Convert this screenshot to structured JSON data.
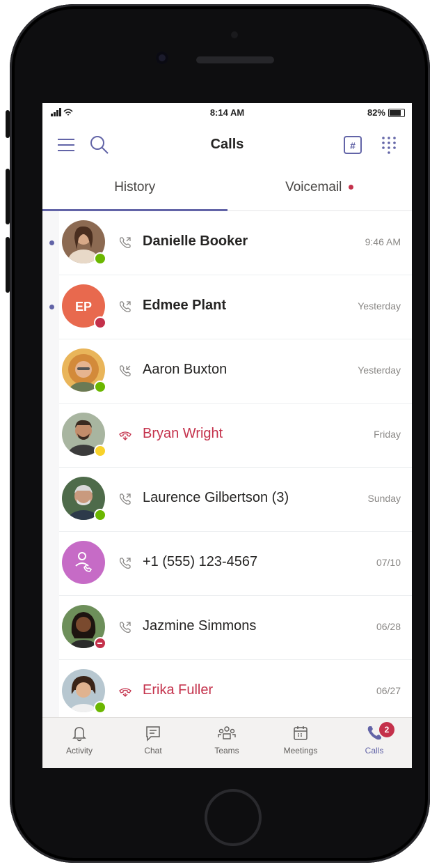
{
  "status": {
    "signal": "atl",
    "time": "8:14 AM",
    "battery": "82%"
  },
  "header": {
    "title": "Calls",
    "menu_icon": "hamburger-menu-icon",
    "search_icon": "search-icon",
    "dialpad_icon": "keypad-icon",
    "grid_icon": "dial-grid-icon"
  },
  "tabs": [
    {
      "label": "History",
      "active": true
    },
    {
      "label": "Voicemail",
      "has_indicator": true
    }
  ],
  "calls": [
    {
      "name": "Danielle Booker",
      "time": "9:46 AM",
      "bold": true,
      "unread": true,
      "missed": false,
      "presence": "available",
      "avatar": "photo"
    },
    {
      "name": "Edmee Plant",
      "time": "Yesterday",
      "bold": true,
      "unread": true,
      "missed": false,
      "presence": "busy",
      "avatar": "initials",
      "initials": "EP"
    },
    {
      "name": "Aaron Buxton",
      "time": "Yesterday",
      "bold": false,
      "unread": false,
      "missed": false,
      "presence": "available",
      "avatar": "photo"
    },
    {
      "name": "Bryan Wright",
      "time": "Friday",
      "bold": false,
      "unread": false,
      "missed": true,
      "presence": "away",
      "avatar": "photo"
    },
    {
      "name": "Laurence Gilbertson (3)",
      "time": "Sunday",
      "bold": false,
      "unread": false,
      "missed": false,
      "presence": "available",
      "avatar": "photo"
    },
    {
      "name": "+1 (555) 123-4567",
      "time": "07/10",
      "bold": false,
      "unread": false,
      "missed": false,
      "presence": "none",
      "avatar": "phone"
    },
    {
      "name": "Jazmine Simmons",
      "time": "06/28",
      "bold": false,
      "unread": false,
      "missed": false,
      "presence": "dnd",
      "avatar": "photo"
    },
    {
      "name": "Erika Fuller",
      "time": "06/27",
      "bold": false,
      "unread": false,
      "missed": true,
      "presence": "available",
      "avatar": "photo"
    }
  ],
  "nav": [
    {
      "label": "Activity",
      "icon": "bell-icon"
    },
    {
      "label": "Chat",
      "icon": "chat-icon"
    },
    {
      "label": "Teams",
      "icon": "teams-icon"
    },
    {
      "label": "Meetings",
      "icon": "calendar-icon"
    },
    {
      "label": "Calls",
      "icon": "phone-icon",
      "active": true,
      "badge": "2"
    }
  ],
  "colors": {
    "accent": "#6264a7",
    "missed": "#c4314b",
    "available": "#6bb700",
    "away": "#f8d22a",
    "ep_avatar": "#e8694e",
    "phone_avatar": "#c66bc6"
  }
}
